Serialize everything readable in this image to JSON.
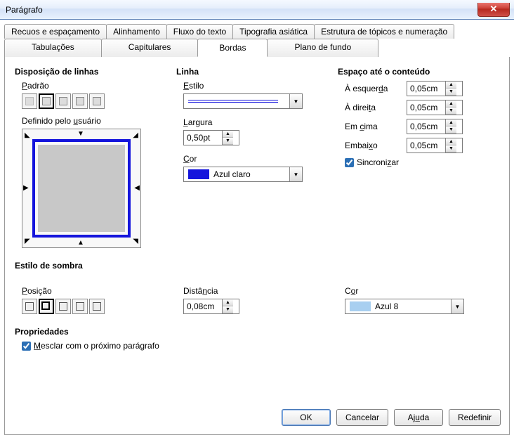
{
  "window": {
    "title": "Parágrafo"
  },
  "tabs_row1": [
    "Recuos e espaçamento",
    "Alinhamento",
    "Fluxo do texto",
    "Tipografia asiática",
    "Estrutura de tópicos e numeração"
  ],
  "tabs_row2": [
    "Tabulações",
    "Capitulares",
    "Bordas",
    "Plano de fundo"
  ],
  "active_tab": "Bordas",
  "line_arrangement": {
    "title": "Disposição de linhas",
    "default_label": "Padrão",
    "user_label": "Definido pelo usuário"
  },
  "line": {
    "title": "Linha",
    "style_label": "Estilo",
    "width_label": "Largura",
    "width_value": "0,50pt",
    "color_label": "Cor",
    "color_value": "Azul claro",
    "color_hex": "#1414dc"
  },
  "spacing": {
    "title": "Espaço até o conteúdo",
    "left_label": "À esquerda",
    "right_label": "À direita",
    "top_label": "Em cima",
    "bottom_label": "Embaixo",
    "left_value": "0,05cm",
    "right_value": "0,05cm",
    "top_value": "0,05cm",
    "bottom_value": "0,05cm",
    "sync_label": "Sincronizar"
  },
  "shadow": {
    "title": "Estilo de sombra",
    "position_label": "Posição",
    "distance_label": "Distância",
    "distance_value": "0,08cm",
    "color_label": "Cor",
    "color_value": "Azul 8",
    "color_hex": "#a8cff0"
  },
  "properties": {
    "title": "Propriedades",
    "merge_label": "Mesclar com o próximo parágrafo"
  },
  "buttons": {
    "ok": "OK",
    "cancel": "Cancelar",
    "help": "Ajuda",
    "reset": "Redefinir"
  }
}
